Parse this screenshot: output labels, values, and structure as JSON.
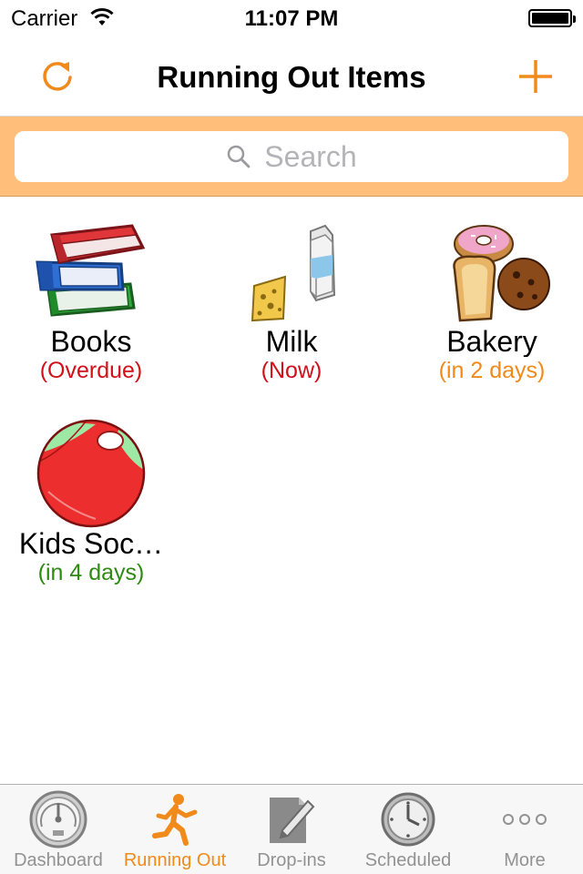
{
  "status_bar": {
    "carrier": "Carrier",
    "time": "11:07 PM"
  },
  "nav": {
    "title": "Running Out Items",
    "left_icon": "refresh-icon",
    "right_icon": "plus-icon"
  },
  "search": {
    "placeholder": "Search"
  },
  "items": [
    {
      "name": "Books",
      "status": "(Overdue)",
      "status_color": "#d0101a",
      "icon": "books-icon"
    },
    {
      "name": "Milk",
      "status": "(Now)",
      "status_color": "#d0101a",
      "icon": "milk-cheese-icon"
    },
    {
      "name": "Bakery",
      "status": "(in 2 days)",
      "status_color": "#f08a1a",
      "icon": "bakery-icon"
    },
    {
      "name": "Kids Soc…",
      "status": "(in 4 days)",
      "status_color": "#2e8a12",
      "icon": "beach-ball-icon"
    }
  ],
  "tabs": [
    {
      "label": "Dashboard",
      "icon": "speedometer-icon",
      "active": false
    },
    {
      "label": "Running Out",
      "icon": "running-man-icon",
      "active": true
    },
    {
      "label": "Drop-ins",
      "icon": "note-pencil-icon",
      "active": false
    },
    {
      "label": "Scheduled",
      "icon": "clock-icon",
      "active": false
    },
    {
      "label": "More",
      "icon": "more-dots-icon",
      "active": false
    }
  ],
  "colors": {
    "accent": "#f08a1a",
    "search_bar": "#ffbf7a"
  }
}
